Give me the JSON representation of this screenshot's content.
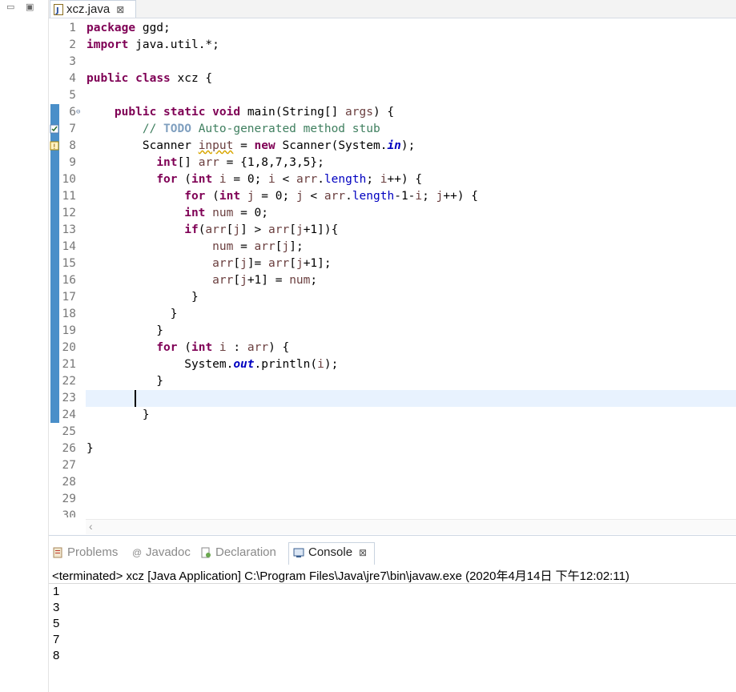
{
  "editor_tab": {
    "title": "xcz.java",
    "close_glyph": "⊠"
  },
  "code_lines": [
    [
      {
        "t": "package",
        "c": "kw"
      },
      {
        "t": " ggd;"
      }
    ],
    [
      {
        "t": "import",
        "c": "kw"
      },
      {
        "t": " java.util.*;"
      }
    ],
    [],
    [
      {
        "t": "public",
        "c": "kw"
      },
      {
        "t": " "
      },
      {
        "t": "class",
        "c": "kw"
      },
      {
        "t": " xcz {"
      }
    ],
    [],
    [
      {
        "t": "    "
      },
      {
        "t": "public",
        "c": "kw"
      },
      {
        "t": " "
      },
      {
        "t": "static",
        "c": "kw"
      },
      {
        "t": " "
      },
      {
        "t": "void",
        "c": "kw"
      },
      {
        "t": " main(String[] "
      },
      {
        "t": "args",
        "c": "var"
      },
      {
        "t": ") {"
      }
    ],
    [
      {
        "t": "        "
      },
      {
        "t": "// ",
        "c": "cm"
      },
      {
        "t": "TODO",
        "c": "todo"
      },
      {
        "t": " Auto-generated method stub",
        "c": "cm"
      }
    ],
    [
      {
        "t": "        Scanner "
      },
      {
        "t": "input",
        "c": "var warn"
      },
      {
        "t": " = "
      },
      {
        "t": "new",
        "c": "kw"
      },
      {
        "t": " Scanner(System."
      },
      {
        "t": "in",
        "c": "sfld"
      },
      {
        "t": ");"
      }
    ],
    [
      {
        "t": "          "
      },
      {
        "t": "int",
        "c": "kw"
      },
      {
        "t": "[] "
      },
      {
        "t": "arr",
        "c": "var"
      },
      {
        "t": " = {1,8,7,3,5};"
      }
    ],
    [
      {
        "t": "          "
      },
      {
        "t": "for",
        "c": "kw"
      },
      {
        "t": " ("
      },
      {
        "t": "int",
        "c": "kw"
      },
      {
        "t": " "
      },
      {
        "t": "i",
        "c": "var"
      },
      {
        "t": " = 0; "
      },
      {
        "t": "i",
        "c": "var"
      },
      {
        "t": " < "
      },
      {
        "t": "arr",
        "c": "var"
      },
      {
        "t": "."
      },
      {
        "t": "length",
        "c": "fld"
      },
      {
        "t": "; "
      },
      {
        "t": "i",
        "c": "var"
      },
      {
        "t": "++) {"
      }
    ],
    [
      {
        "t": "              "
      },
      {
        "t": "for",
        "c": "kw"
      },
      {
        "t": " ("
      },
      {
        "t": "int",
        "c": "kw"
      },
      {
        "t": " "
      },
      {
        "t": "j",
        "c": "var"
      },
      {
        "t": " = 0; "
      },
      {
        "t": "j",
        "c": "var"
      },
      {
        "t": " < "
      },
      {
        "t": "arr",
        "c": "var"
      },
      {
        "t": "."
      },
      {
        "t": "length",
        "c": "fld"
      },
      {
        "t": "-1-"
      },
      {
        "t": "i",
        "c": "var"
      },
      {
        "t": "; "
      },
      {
        "t": "j",
        "c": "var"
      },
      {
        "t": "++) {"
      }
    ],
    [
      {
        "t": "              "
      },
      {
        "t": "int",
        "c": "kw"
      },
      {
        "t": " "
      },
      {
        "t": "num",
        "c": "var"
      },
      {
        "t": " = 0;"
      }
    ],
    [
      {
        "t": "              "
      },
      {
        "t": "if",
        "c": "kw"
      },
      {
        "t": "("
      },
      {
        "t": "arr",
        "c": "var"
      },
      {
        "t": "["
      },
      {
        "t": "j",
        "c": "var"
      },
      {
        "t": "] > "
      },
      {
        "t": "arr",
        "c": "var"
      },
      {
        "t": "["
      },
      {
        "t": "j",
        "c": "var"
      },
      {
        "t": "+1]){"
      }
    ],
    [
      {
        "t": "                  "
      },
      {
        "t": "num",
        "c": "var"
      },
      {
        "t": " = "
      },
      {
        "t": "arr",
        "c": "var"
      },
      {
        "t": "["
      },
      {
        "t": "j",
        "c": "var"
      },
      {
        "t": "];"
      }
    ],
    [
      {
        "t": "                  "
      },
      {
        "t": "arr",
        "c": "var"
      },
      {
        "t": "["
      },
      {
        "t": "j",
        "c": "var"
      },
      {
        "t": "]= "
      },
      {
        "t": "arr",
        "c": "var"
      },
      {
        "t": "["
      },
      {
        "t": "j",
        "c": "var"
      },
      {
        "t": "+1];"
      }
    ],
    [
      {
        "t": "                  "
      },
      {
        "t": "arr",
        "c": "var"
      },
      {
        "t": "["
      },
      {
        "t": "j",
        "c": "var"
      },
      {
        "t": "+1] = "
      },
      {
        "t": "num",
        "c": "var"
      },
      {
        "t": ";"
      }
    ],
    [
      {
        "t": "               }"
      }
    ],
    [
      {
        "t": "            }"
      }
    ],
    [
      {
        "t": "          }"
      }
    ],
    [
      {
        "t": "          "
      },
      {
        "t": "for",
        "c": "kw"
      },
      {
        "t": " ("
      },
      {
        "t": "int",
        "c": "kw"
      },
      {
        "t": " "
      },
      {
        "t": "i",
        "c": "var"
      },
      {
        "t": " : "
      },
      {
        "t": "arr",
        "c": "var"
      },
      {
        "t": ") {"
      }
    ],
    [
      {
        "t": "              System."
      },
      {
        "t": "out",
        "c": "sfld"
      },
      {
        "t": ".println("
      },
      {
        "t": "i",
        "c": "var"
      },
      {
        "t": ");"
      }
    ],
    [
      {
        "t": "          }"
      }
    ],
    [],
    [
      {
        "t": "        }"
      }
    ],
    [],
    [
      {
        "t": "}"
      }
    ],
    [],
    [],
    [],
    []
  ],
  "bottom_tabs": [
    {
      "label": "Problems"
    },
    {
      "label": "Javadoc"
    },
    {
      "label": "Declaration"
    },
    {
      "label": "Console"
    }
  ],
  "console": {
    "header": "<terminated> xcz [Java Application] C:\\Program Files\\Java\\jre7\\bin\\javaw.exe (2020年4月14日 下午12:02:11)",
    "output": [
      "1",
      "3",
      "5",
      "7",
      "8"
    ]
  },
  "colors": {
    "keyword": "#7f0055",
    "comment": "#3f7f5f",
    "field": "#0000c0",
    "local_var": "#6a3e3e",
    "current_line": "#e8f2fe",
    "ruler": "#4a8fc9"
  }
}
